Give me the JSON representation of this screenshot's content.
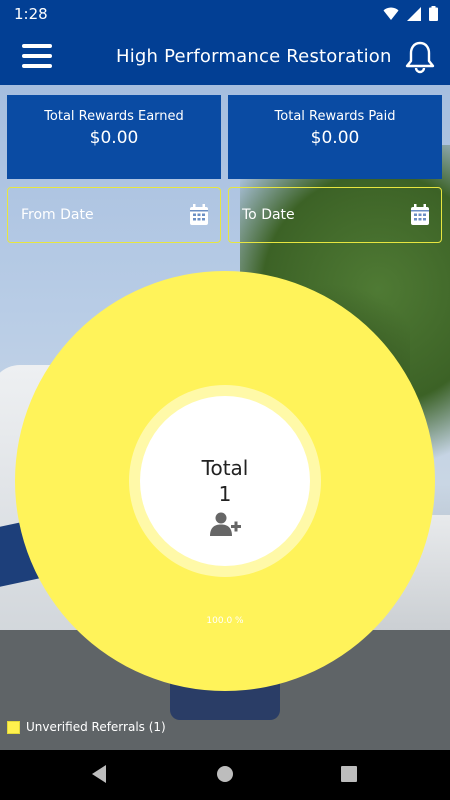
{
  "status_bar": {
    "time": "1:28",
    "icons": [
      "wifi-icon",
      "signal-icon",
      "battery-icon"
    ]
  },
  "app_bar": {
    "title": "High Performance Restoration",
    "menu_icon": "hamburger-menu-icon",
    "notification_icon": "bell-icon"
  },
  "cards": {
    "earned": {
      "label": "Total Rewards Earned",
      "value": "$0.00"
    },
    "paid": {
      "label": "Total Rewards Paid",
      "value": "$0.00"
    }
  },
  "date_filters": {
    "from": {
      "placeholder": "From Date",
      "icon": "calendar-icon"
    },
    "to": {
      "placeholder": "To Date",
      "icon": "calendar-icon"
    }
  },
  "chart_data": {
    "type": "pie",
    "center_label": "Total",
    "center_value": "1",
    "center_icon": "add-user-icon",
    "slices": [
      {
        "name": "Unverified Referrals",
        "value": 1,
        "percent_label": "100.0 %",
        "color": "#fff35a"
      }
    ],
    "legend": [
      {
        "label": "Unverified Referrals (1)",
        "color": "#fff35a"
      }
    ],
    "legend_position": "bottom-left"
  },
  "nav_bar": {
    "buttons": [
      "back-icon",
      "home-icon",
      "recents-icon"
    ]
  },
  "colors": {
    "primary": "#023f94",
    "card": "#0a4ba3",
    "accent": "#fff35a",
    "date_border": "#e7e640"
  }
}
